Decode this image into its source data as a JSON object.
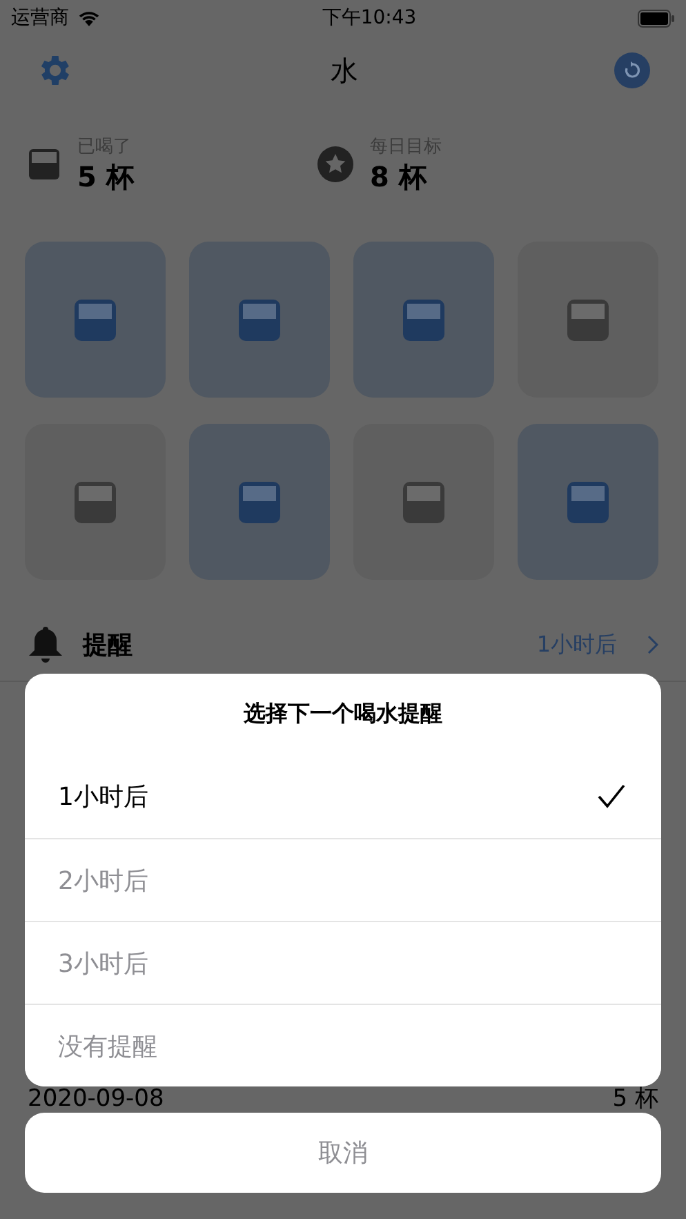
{
  "status_bar": {
    "carrier": "运营商",
    "time": "下午10:43"
  },
  "nav": {
    "title": "水"
  },
  "stats": [
    {
      "kind": "drunk",
      "label": "已喝了",
      "value": "5 杯"
    },
    {
      "kind": "goal",
      "label": "每日目标",
      "value": "8 杯"
    }
  ],
  "cups": [
    {
      "filled": true
    },
    {
      "filled": true
    },
    {
      "filled": true
    },
    {
      "filled": false
    },
    {
      "filled": false
    },
    {
      "filled": true
    },
    {
      "filled": false
    },
    {
      "filled": true
    }
  ],
  "reminder": {
    "label": "提醒",
    "value": "1小时后"
  },
  "history": [
    {
      "date": "2020-09-08",
      "count": "5 杯"
    }
  ],
  "sheet": {
    "title": "选择下一个喝水提醒",
    "options": [
      {
        "label": "1小时后",
        "selected": true
      },
      {
        "label": "2小时后",
        "selected": false
      },
      {
        "label": "3小时后",
        "selected": false
      },
      {
        "label": "没有提醒",
        "selected": false
      }
    ],
    "cancel": "取消"
  }
}
